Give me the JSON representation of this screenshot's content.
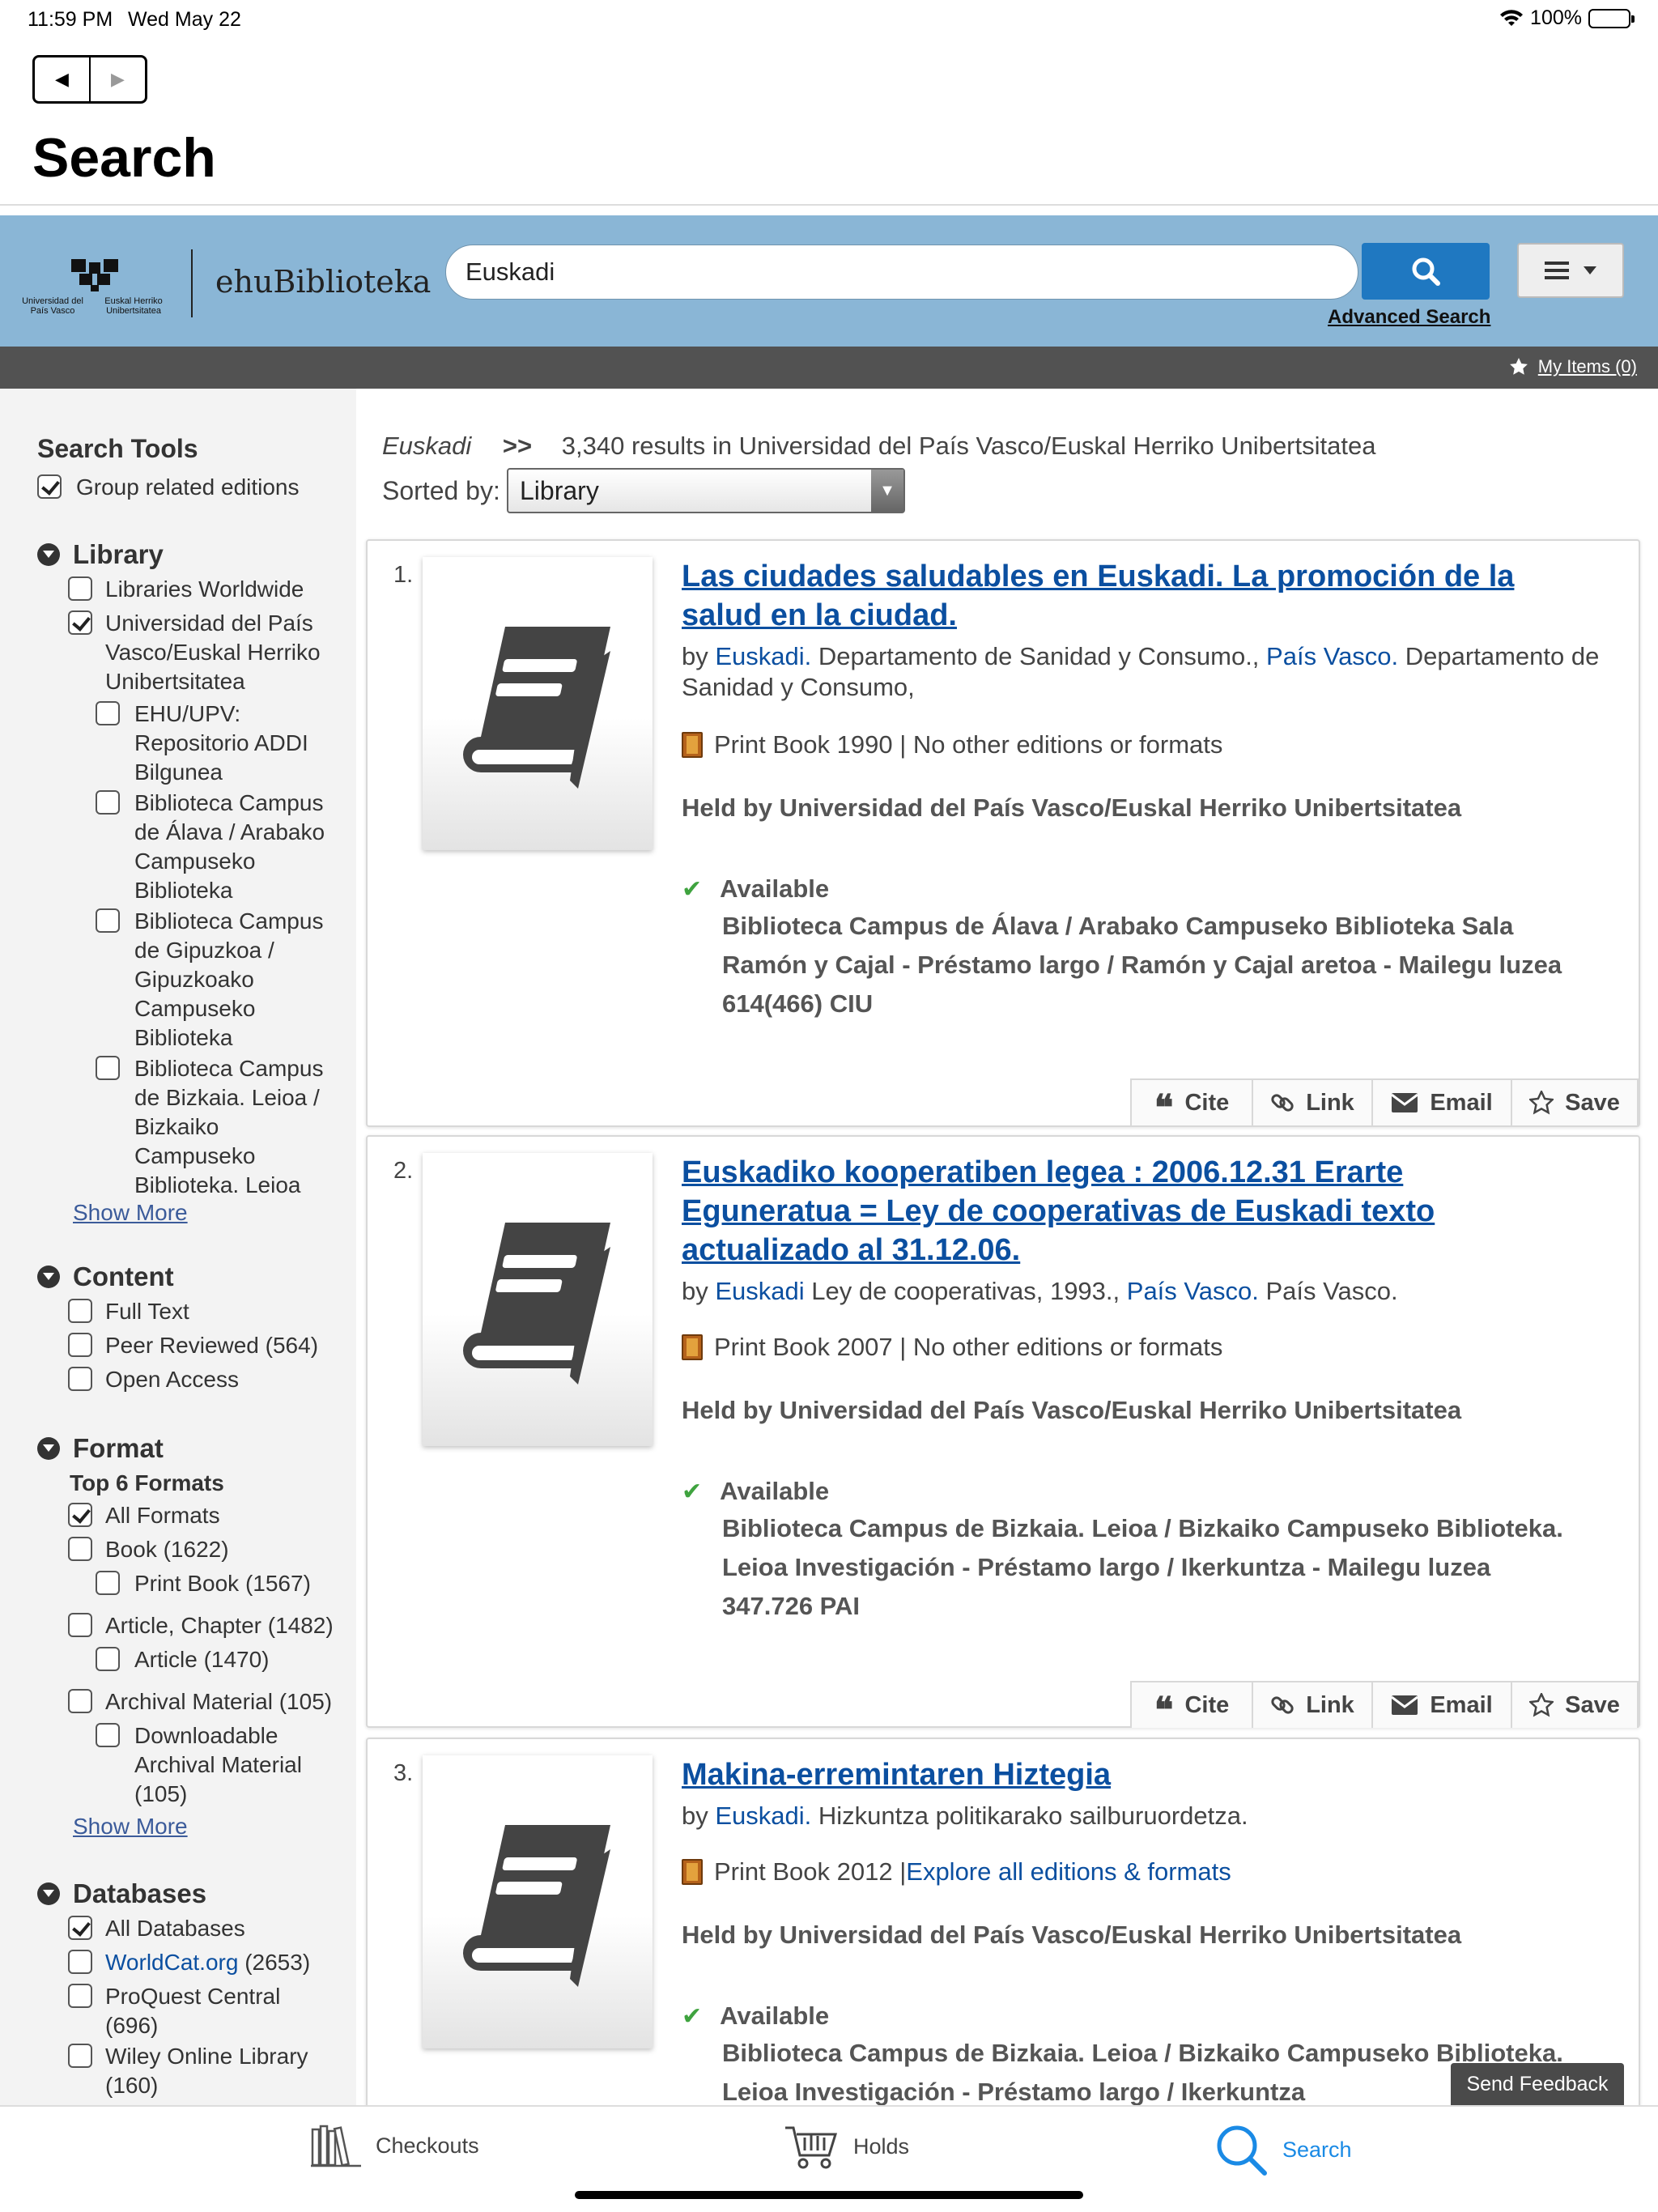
{
  "status": {
    "time": "11:59 PM",
    "date": "Wed May 22",
    "battery": "100%"
  },
  "nav": {
    "back": "◀",
    "forward": "▶",
    "title": "Search"
  },
  "banner": {
    "logo_left": "Universidad del País Vasco",
    "logo_right": "Euskal Herriko Unibertsitatea",
    "brand": "ehuBiblioteka",
    "search_value": "Euskadi",
    "advanced": "Advanced Search",
    "my_items": "My Items (0)"
  },
  "sidebar": {
    "search_tools": "Search Tools",
    "group_editions": "Group related editions",
    "library": {
      "heading": "Library",
      "worldwide": "Libraries Worldwide",
      "upv": [
        "Universidad del País",
        "Vasco/Euskal Herriko",
        "Unibertsitatea"
      ],
      "ehu": [
        "EHU/UPV:",
        "Repositorio ADDI",
        "Bilgunea"
      ],
      "alava": [
        "Biblioteca Campus",
        "de Álava / Arabako",
        "Campuseko",
        "Biblioteka"
      ],
      "gipuzkoa": [
        "Biblioteca Campus",
        "de Gipuzkoa /",
        "Gipuzkoako",
        "Campuseko",
        "Biblioteka"
      ],
      "bizkaia": [
        "Biblioteca Campus",
        "de Bizkaia. Leioa /",
        "Bizkaiko",
        "Campuseko",
        "Biblioteka. Leioa"
      ],
      "show_more": "Show More"
    },
    "content": {
      "heading": "Content",
      "full_text": "Full Text",
      "peer": "Peer Reviewed (564)",
      "open": "Open Access"
    },
    "format": {
      "heading": "Format",
      "top": "Top 6 Formats",
      "all": "All Formats",
      "book": "Book (1622)",
      "print_book": "Print Book (1567)",
      "article_chapter": "Article, Chapter (1482)",
      "article": "Article (1470)",
      "archival": "Archival Material (105)",
      "downloadable": [
        "Downloadable",
        "Archival Material",
        "(105)"
      ],
      "show_more": "Show More"
    },
    "databases": {
      "heading": "Databases",
      "all": "All Databases",
      "worldcat_link": "WorldCat.org",
      "worldcat_count": " (2653)",
      "proquest": [
        "ProQuest Central",
        "(696)"
      ],
      "wiley": [
        "Wiley Online Library",
        "(160)"
      ]
    }
  },
  "results": {
    "query": "Euskadi",
    "separator": ">>",
    "summary": "3,340 results in Universidad del País Vasco/Euskal Herriko Unibertsitatea",
    "sorted_label": "Sorted by:",
    "sort_value": "Library",
    "actions": {
      "cite": "Cite",
      "link": "Link",
      "email": "Email",
      "save": "Save"
    },
    "items": [
      {
        "num": "1.",
        "title": "Las ciudades saludables en Euskadi. La promoción de la salud en la ciudad.",
        "by": "by ",
        "author1": "Euskadi.",
        "mid": " Departamento de Sanidad y Consumo., ",
        "author2": "País Vasco.",
        "rest": " Departamento de Sanidad y Consumo,",
        "format": "Print Book 1990 | No other editions or formats",
        "held": "Held by Universidad del País Vasco/Euskal Herriko Unibertsitatea",
        "available": "Available",
        "location": "Biblioteca Campus de Álava / Arabako Campuseko Biblioteka Sala Ramón y Cajal - Préstamo largo / Ramón y Cajal aretoa - Mailegu luzea",
        "call": "614(466) CIU"
      },
      {
        "num": "2.",
        "title": "Euskadiko kooperatiben legea : 2006.12.31 Erarte Eguneratua = Ley de cooperativas de Euskadi texto actualizado al 31.12.06.",
        "by": "by ",
        "author1": "Euskadi",
        "mid": " Ley de cooperativas, 1993., ",
        "author2": "País Vasco.",
        "rest": " País Vasco.",
        "format": "Print Book 2007 | No other editions or formats",
        "held": "Held by Universidad del País Vasco/Euskal Herriko Unibertsitatea",
        "available": "Available",
        "location": "Biblioteca Campus de Bizkaia. Leioa / Bizkaiko Campuseko Biblioteka. Leioa Investigación - Préstamo largo / Ikerkuntza - Mailegu luzea",
        "call": "347.726 PAI"
      },
      {
        "num": "3.",
        "title": "Makina-erremintaren Hiztegia",
        "by": "by ",
        "author1": "Euskadi.",
        "mid": " Hizkuntza politikarako sailburuordetza.",
        "format_prefix": "Print Book 2012 | ",
        "format_link": "Explore all editions & formats",
        "held": "Held by Universidad del País Vasco/Euskal Herriko Unibertsitatea",
        "available": "Available",
        "location": "Biblioteca Campus de Bizkaia. Leioa / Bizkaiko Campuseko Biblioteka. Leioa Investigación - Préstamo largo / Ikerkuntza"
      }
    ]
  },
  "feedback": "Send Feedback",
  "tabs": {
    "checkouts": "Checkouts",
    "holds": "Holds",
    "search": "Search"
  },
  "colors": {
    "banner": "#8ab6d6",
    "accent": "#1f78c1",
    "link": "#0b4fa0",
    "tab_active": "#1a8ae5"
  }
}
